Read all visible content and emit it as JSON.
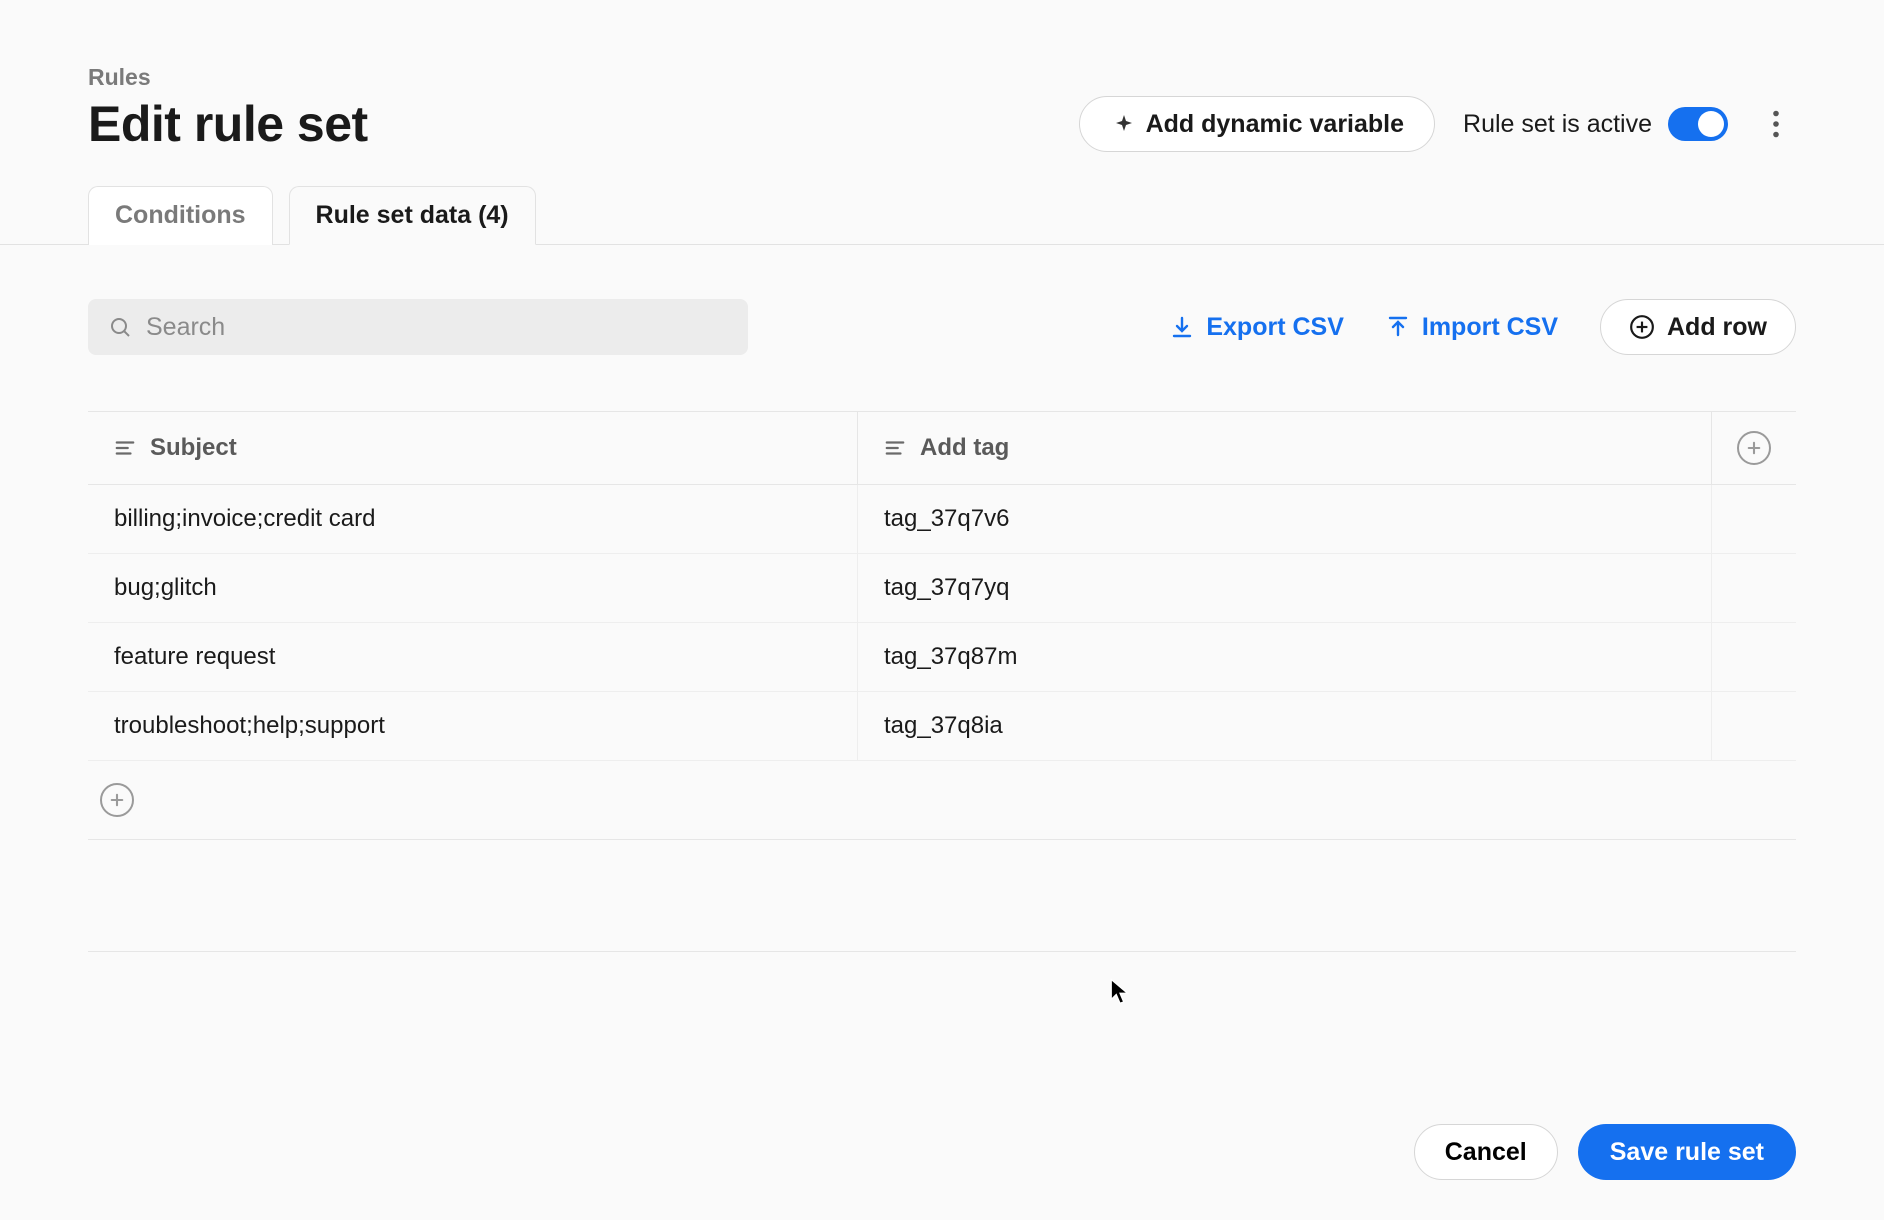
{
  "breadcrumb": "Rules",
  "title": "Edit rule set",
  "header": {
    "add_dynamic_label": "Add dynamic variable",
    "toggle_label": "Rule set is active",
    "toggle_on": true
  },
  "tabs": {
    "conditions": "Conditions",
    "data": "Rule set data (4)"
  },
  "toolbar": {
    "search_placeholder": "Search",
    "export_label": "Export CSV",
    "import_label": "Import CSV",
    "add_row_label": "Add row"
  },
  "table": {
    "columns": {
      "subject": "Subject",
      "tag": "Add tag"
    },
    "rows": [
      {
        "subject": "billing;invoice;credit card",
        "tag": "tag_37q7v6"
      },
      {
        "subject": "bug;glitch",
        "tag": "tag_37q7yq"
      },
      {
        "subject": "feature request",
        "tag": "tag_37q87m"
      },
      {
        "subject": "troubleshoot;help;support",
        "tag": "tag_37q8ia"
      }
    ]
  },
  "footer": {
    "cancel": "Cancel",
    "save": "Save rule set"
  }
}
